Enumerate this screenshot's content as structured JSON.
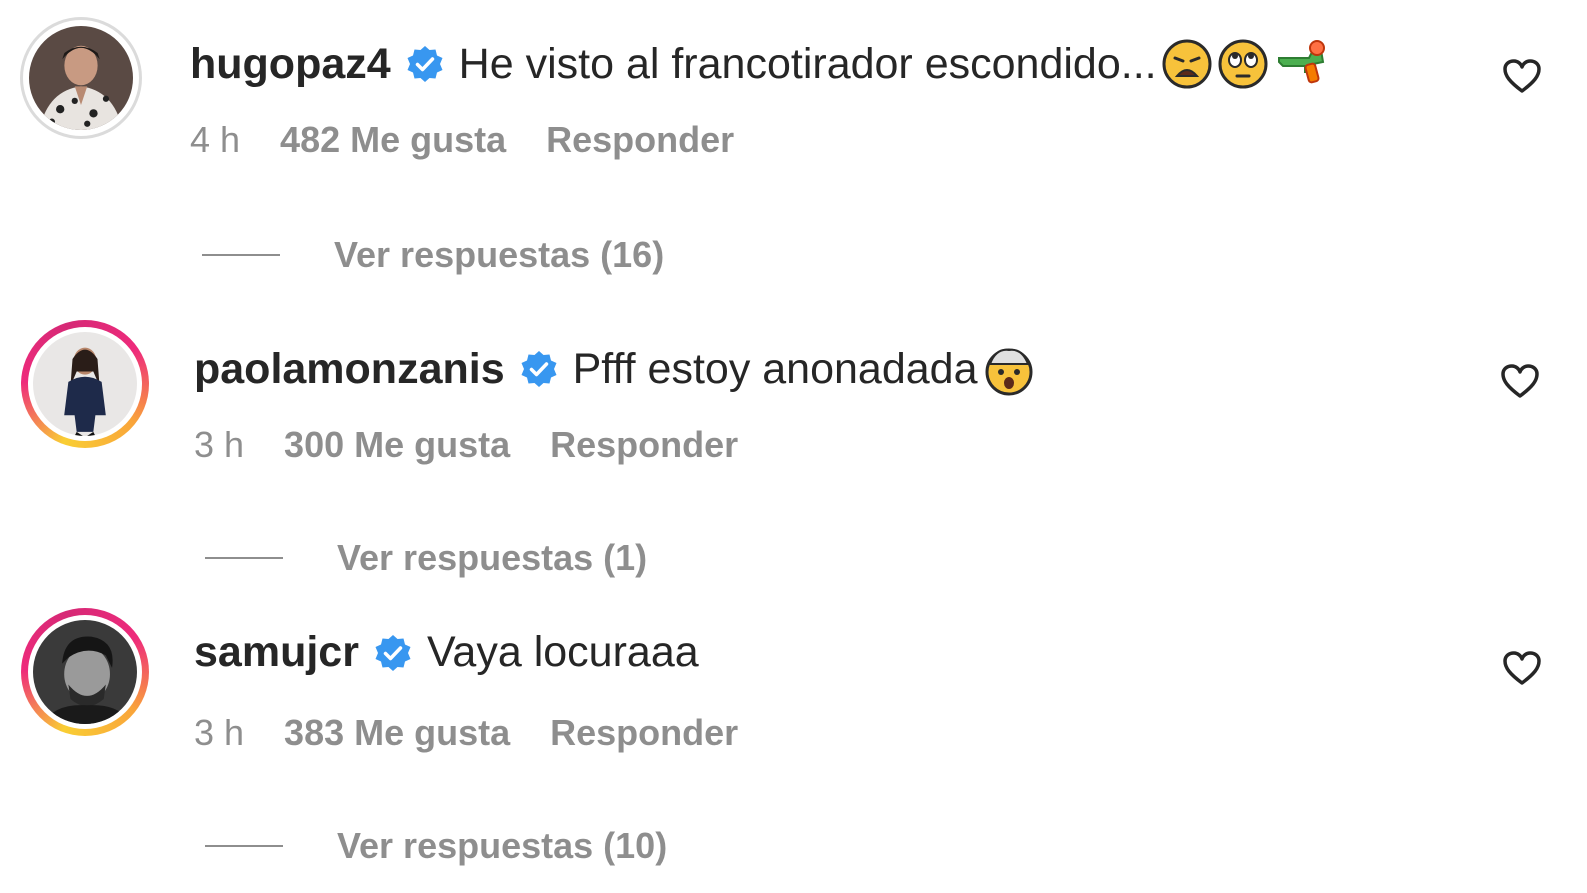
{
  "comments": [
    {
      "username": "hugopaz4",
      "text": "He visto al francotirador escondido...",
      "emojis": [
        "weary-face-emoji",
        "face-with-rolling-eyes-emoji",
        "water-pistol-emoji"
      ],
      "time": "4 h",
      "likes": "482 Me gusta",
      "reply": "Responder",
      "view_replies": "Ver respuestas (16)",
      "verified": true,
      "story_ring": false
    },
    {
      "username": "paolamonzanis",
      "text": "Pfff estoy anonadada",
      "emojis": [
        "exploding-head-emoji"
      ],
      "time": "3 h",
      "likes": "300 Me gusta",
      "reply": "Responder",
      "view_replies": "Ver respuestas (1)",
      "verified": true,
      "story_ring": true
    },
    {
      "username": "samujcr",
      "text": "Vaya locuraaa",
      "emojis": [],
      "time": "3 h",
      "likes": "383 Me gusta",
      "reply": "Responder",
      "view_replies": "Ver respuestas (10)",
      "verified": true,
      "story_ring": true
    }
  ],
  "colors": {
    "text": "#262626",
    "muted": "#8e8e8e",
    "verified_blue": "#3897f0",
    "story_gradient": [
      "#f9ce34",
      "#ee2a7b",
      "#6228d7"
    ]
  }
}
